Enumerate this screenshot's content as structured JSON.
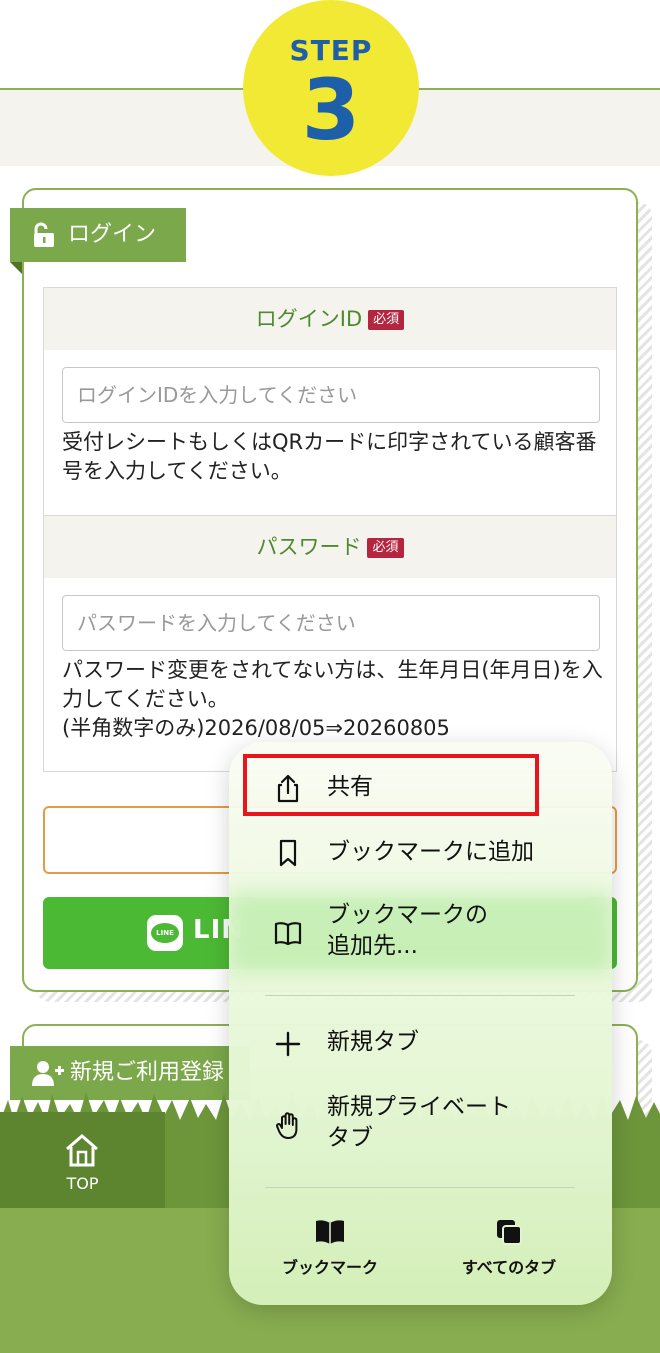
{
  "step": {
    "word": "STEP",
    "number": "3"
  },
  "login": {
    "ribbon_label": "ログイン",
    "login_id": {
      "label": "ログインID",
      "required": "必須",
      "placeholder": "ログインIDを入力してください",
      "help": "受付レシートもしくはQRカードに印字されている顧客番号を入力してください。"
    },
    "password": {
      "label": "パスワード",
      "required": "必須",
      "placeholder": "パスワードを入力してください",
      "help_line1": "パスワード変更をされてない方は、生年月日(年月日)を入力してください。",
      "help_line2": "(半角数字のみ)2026/08/05⇒20260805"
    },
    "line_button": {
      "icon_text": "LINE",
      "label": "LIN"
    }
  },
  "register": {
    "ribbon_label": "新規ご利用登録"
  },
  "footer": {
    "top_label": "TOP"
  },
  "context_menu": {
    "items": [
      {
        "icon": "share-icon",
        "label": "共有"
      },
      {
        "icon": "bookmark-icon",
        "label": "ブックマークに追加"
      },
      {
        "icon": "book-open-icon",
        "label_line1": "ブックマークの",
        "label_line2": "追加先..."
      },
      {
        "icon": "plus-icon",
        "label": "新規タブ"
      },
      {
        "icon": "hand-icon",
        "label_line1": "新規プライベート",
        "label_line2": "タブ"
      }
    ],
    "bottom": [
      {
        "icon": "bookmarks-book-icon",
        "label": "ブックマーク"
      },
      {
        "icon": "all-tabs-icon",
        "label": "すべてのタブ"
      }
    ]
  },
  "colors": {
    "accent_green": "#7ba84a",
    "step_yellow": "#f2e935",
    "step_blue": "#1d5fa8",
    "required_red": "#b4253f",
    "highlight_red": "#e8161c"
  }
}
